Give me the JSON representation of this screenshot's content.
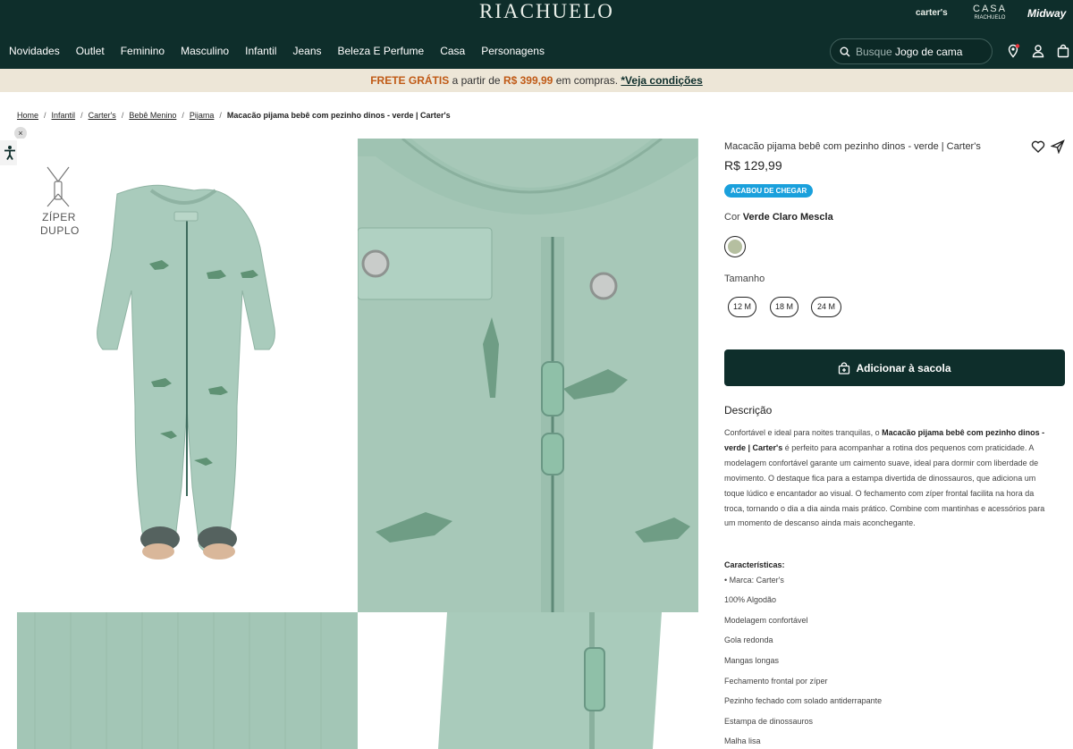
{
  "header": {
    "logo": "RIACHUELO",
    "brands": {
      "carters": "carter's",
      "casa": "CASA",
      "casa_sub": "RIACHUELO",
      "midway": "Midway"
    },
    "nav": [
      "Novidades",
      "Outlet",
      "Feminino",
      "Masculino",
      "Infantil",
      "Jeans",
      "Beleza E Perfume",
      "Casa",
      "Personagens"
    ],
    "search": {
      "prefix": "Busque",
      "term": "Jogo de cama"
    },
    "icons": [
      "location-icon",
      "user-icon",
      "bag-icon"
    ]
  },
  "promo": {
    "highlight": "FRETE GRÁTIS",
    "text1": "a partir de",
    "amount": "R$ 399,99",
    "text2": "em compras.",
    "link": "*Veja condições"
  },
  "breadcrumb": {
    "items": [
      "Home",
      "Infantil",
      "Carter's",
      "Bebê Menino",
      "Pijama"
    ],
    "current": "Macacão pijama bebê com pezinho dinos - verde | Carter's",
    "sep": "/"
  },
  "accessibility": {
    "close": "×"
  },
  "gallery": {
    "ziper_line1": "ZÍPER",
    "ziper_line2": "DUPLO"
  },
  "product": {
    "title": "Macacão pijama bebê com pezinho dinos - verde | Carter's",
    "price": "R$ 129,99",
    "badge": "ACABOU DE CHEGAR",
    "color_label": "Cor",
    "color_value": "Verde Claro Mescla",
    "swatch_color": "#b5bfa0",
    "size_label": "Tamanho",
    "sizes": [
      "12 M",
      "18 M",
      "24 M"
    ],
    "add_button": "Adicionar à sacola",
    "description_heading": "Descrição",
    "desc_1": "Confortável e ideal para noites tranquilas, o ",
    "desc_bold": "Macacão pijama bebê com pezinho dinos - verde | Carter's",
    "desc_2": " é perfeito para acompanhar a rotina dos pequenos com praticidade. A modelagem confortável garante um caimento suave, ideal para dormir com liberdade de movimento. O destaque fica para a estampa divertida de dinossauros, que adiciona um toque lúdico e encantador ao visual. O fechamento com zíper frontal facilita na hora da troca, tornando o dia a dia ainda mais prático. Combine com mantinhas e acessórios para um momento de descanso ainda mais aconchegante.",
    "characteristics_heading": "Características:",
    "characteristics": [
      "• Marca: Carter's",
      "100% Algodão",
      "Modelagem confortável",
      "Gola redonda",
      "Mangas longas",
      "Fechamento frontal por zíper",
      "Pezinho fechado com solado antiderrapante",
      "Estampa de dinossauros",
      "Malha lisa"
    ]
  },
  "colors": {
    "header_bg": "#0e2e2b",
    "promo_bg": "#ede6d7",
    "promo_accent": "#c05a16",
    "badge": "#1aa0dc",
    "garment": "#a7c8b8"
  }
}
